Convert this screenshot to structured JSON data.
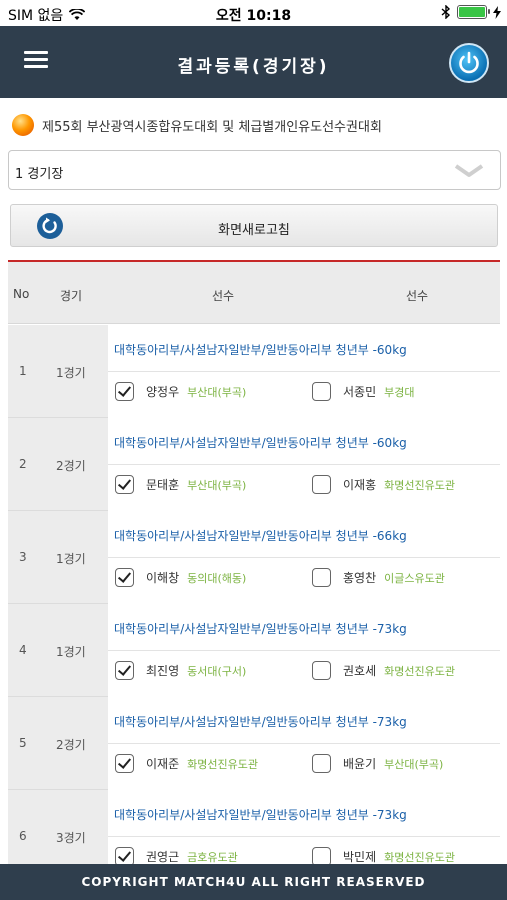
{
  "status_bar": {
    "carrier": "SIM 없음",
    "time": "오전 10:18"
  },
  "header": {
    "title": "결과등록(경기장)",
    "menu_icon": "hamburger-icon",
    "power_icon": "power-icon"
  },
  "competition": {
    "title": "제55회 부산광역시종합유도대회 및 체급별개인유도선수권대회"
  },
  "stadium_select": {
    "selected": "1 경기장"
  },
  "refresh": {
    "label": "화면새로고침"
  },
  "table": {
    "columns": [
      "No",
      "경기",
      "선수",
      "선수"
    ],
    "rows": [
      {
        "no": "1",
        "round": "1경기",
        "division": "대학동아리부/사설남자일반부/일반동아리부 청년부 -60kg",
        "player1": {
          "name": "양정우",
          "team": "부산대(부곡)",
          "checked": true
        },
        "player2": {
          "name": "서종민",
          "team": "부경대",
          "checked": false
        }
      },
      {
        "no": "2",
        "round": "2경기",
        "division": "대학동아리부/사설남자일반부/일반동아리부 청년부 -60kg",
        "player1": {
          "name": "문태훈",
          "team": "부산대(부곡)",
          "checked": true
        },
        "player2": {
          "name": "이재홍",
          "team": "화명선진유도관",
          "checked": false
        }
      },
      {
        "no": "3",
        "round": "1경기",
        "division": "대학동아리부/사설남자일반부/일반동아리부 청년부 -66kg",
        "player1": {
          "name": "이해창",
          "team": "동의대(해동)",
          "checked": true
        },
        "player2": {
          "name": "홍영찬",
          "team": "이글스유도관",
          "checked": false
        }
      },
      {
        "no": "4",
        "round": "1경기",
        "division": "대학동아리부/사설남자일반부/일반동아리부 청년부 -73kg",
        "player1": {
          "name": "최진영",
          "team": "동서대(구서)",
          "checked": true
        },
        "player2": {
          "name": "권호세",
          "team": "화명선진유도관",
          "checked": false
        }
      },
      {
        "no": "5",
        "round": "2경기",
        "division": "대학동아리부/사설남자일반부/일반동아리부 청년부 -73kg",
        "player1": {
          "name": "이재준",
          "team": "화명선진유도관",
          "checked": true
        },
        "player2": {
          "name": "배윤기",
          "team": "부산대(부곡)",
          "checked": false
        }
      },
      {
        "no": "6",
        "round": "3경기",
        "division": "대학동아리부/사설남자일반부/일반동아리부 청년부 -73kg",
        "player1": {
          "name": "권영근",
          "team": "금호유도관",
          "checked": true
        },
        "player2": {
          "name": "박민제",
          "team": "화명선진유도관",
          "checked": false
        }
      }
    ]
  },
  "footer": {
    "text": "COPYRIGHT MATCH4U ALL RIGHT REASERVED"
  },
  "colors": {
    "header_bg": "#2f3e4d",
    "division_text": "#1a5fa8",
    "team_text": "#7cb342",
    "table_accent": "#c62828"
  }
}
